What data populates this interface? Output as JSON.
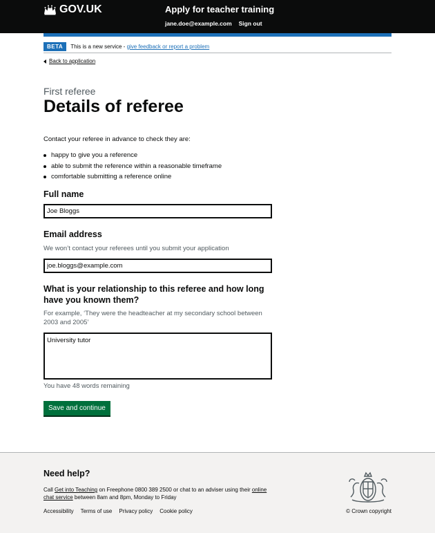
{
  "header": {
    "logo_text": "GOV.UK",
    "service_name": "Apply for teacher training",
    "nav": [
      {
        "label": "jane.doe@example.com"
      },
      {
        "label": "Sign out"
      }
    ]
  },
  "phase": {
    "tag": "BETA",
    "text": "This is a new service -",
    "link": "give feedback or report a problem"
  },
  "back_link": "Back to application",
  "caption": "First referee",
  "title": "Details of referee",
  "intro": "Contact your referee in advance to check they are:",
  "bullets": [
    "happy to give you a reference",
    "able to submit the reference within a reasonable timeframe",
    "comfortable submitting a reference online"
  ],
  "form": {
    "full_name": {
      "label": "Full name",
      "value": "Joe Bloggs"
    },
    "email": {
      "label": "Email address",
      "hint": "We won’t contact your referees until you submit your application",
      "value": "joe.bloggs@example.com"
    },
    "relationship": {
      "label": "What is your relationship to this referee and how long have you known them?",
      "hint": "For example, ‘They were the headteacher at my secondary school between 2003 and 2005’",
      "value": "University tutor",
      "count_message": "You have 48 words remaining"
    },
    "submit_label": "Save and continue"
  },
  "footer": {
    "title": "Need help?",
    "help_prefix": "Call",
    "help_link1": "Get into Teaching",
    "help_middle": "on Freephone 0800 389 2500 or chat to an adviser using their",
    "help_link2": "online chat service",
    "help_suffix": "between 8am and 8pm, Monday to Friday",
    "links": [
      "Accessibility",
      "Terms of use",
      "Privacy policy",
      "Cookie policy"
    ],
    "copyright": "© Crown copyright"
  },
  "colors": {
    "header_bg": "#0b0c0c",
    "brand_blue": "#1d70b8",
    "button_green": "#00703c",
    "footer_bg": "#f3f2f1"
  }
}
